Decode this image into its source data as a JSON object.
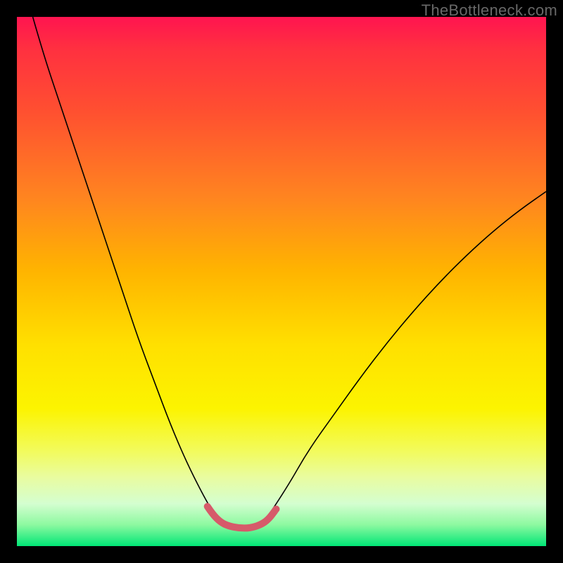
{
  "watermark_text": "TheBottleneck.com",
  "chart_data": {
    "type": "line",
    "title": "",
    "xlabel": "",
    "ylabel": "",
    "xlim": [
      0,
      100
    ],
    "ylim": [
      0,
      100
    ],
    "grid": false,
    "legend": null,
    "series": [
      {
        "name": "left-curve",
        "color": "#000000",
        "stroke_width": 1.6,
        "points": [
          {
            "x": 3,
            "y": 100
          },
          {
            "x": 5,
            "y": 93
          },
          {
            "x": 8,
            "y": 84
          },
          {
            "x": 11,
            "y": 75
          },
          {
            "x": 14,
            "y": 66
          },
          {
            "x": 17,
            "y": 57
          },
          {
            "x": 20,
            "y": 48
          },
          {
            "x": 23,
            "y": 39
          },
          {
            "x": 26,
            "y": 31
          },
          {
            "x": 29,
            "y": 23
          },
          {
            "x": 32,
            "y": 16
          },
          {
            "x": 35,
            "y": 10
          },
          {
            "x": 37,
            "y": 6.5
          }
        ]
      },
      {
        "name": "right-curve",
        "color": "#000000",
        "stroke_width": 1.6,
        "points": [
          {
            "x": 48,
            "y": 6.5
          },
          {
            "x": 51,
            "y": 11
          },
          {
            "x": 55,
            "y": 18
          },
          {
            "x": 60,
            "y": 25
          },
          {
            "x": 65,
            "y": 32
          },
          {
            "x": 70,
            "y": 38.5
          },
          {
            "x": 75,
            "y": 44.5
          },
          {
            "x": 80,
            "y": 50
          },
          {
            "x": 85,
            "y": 55
          },
          {
            "x": 90,
            "y": 59.5
          },
          {
            "x": 95,
            "y": 63.5
          },
          {
            "x": 100,
            "y": 67
          }
        ]
      },
      {
        "name": "valley-highlight",
        "color": "#d65a6a",
        "stroke_width": 10,
        "linecap": "round",
        "points": [
          {
            "x": 36,
            "y": 7.5
          },
          {
            "x": 37,
            "y": 6
          },
          {
            "x": 38.5,
            "y": 4.5
          },
          {
            "x": 40,
            "y": 3.8
          },
          {
            "x": 42,
            "y": 3.4
          },
          {
            "x": 44,
            "y": 3.4
          },
          {
            "x": 46,
            "y": 4
          },
          {
            "x": 47.5,
            "y": 5
          },
          {
            "x": 49,
            "y": 7
          }
        ]
      }
    ]
  }
}
